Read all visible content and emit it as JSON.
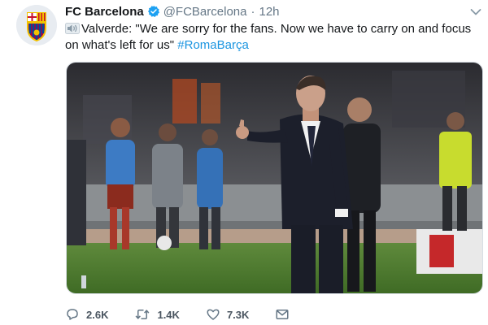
{
  "tweet": {
    "author_name": "FC Barcelona",
    "handle": "@FCBarcelona",
    "separator": "·",
    "time": "12h",
    "text_main": "Valverde: \"We are sorry for the fans. Now we have to carry on and focus on what's left for us\" ",
    "hashtag": "#RomaBarça",
    "media_icon": "photo",
    "verified_icon": "verified-badge-icon",
    "colors": {
      "link": "#1b95e0",
      "muted": "#657786",
      "verified": "#1da1f2"
    }
  },
  "actions": {
    "reply_count": "2.6K",
    "retweet_count": "1.4K",
    "like_count": "7.3K",
    "reply_icon": "reply-icon",
    "retweet_icon": "retweet-icon",
    "like_icon": "heart-icon",
    "dm_icon": "envelope-icon"
  }
}
